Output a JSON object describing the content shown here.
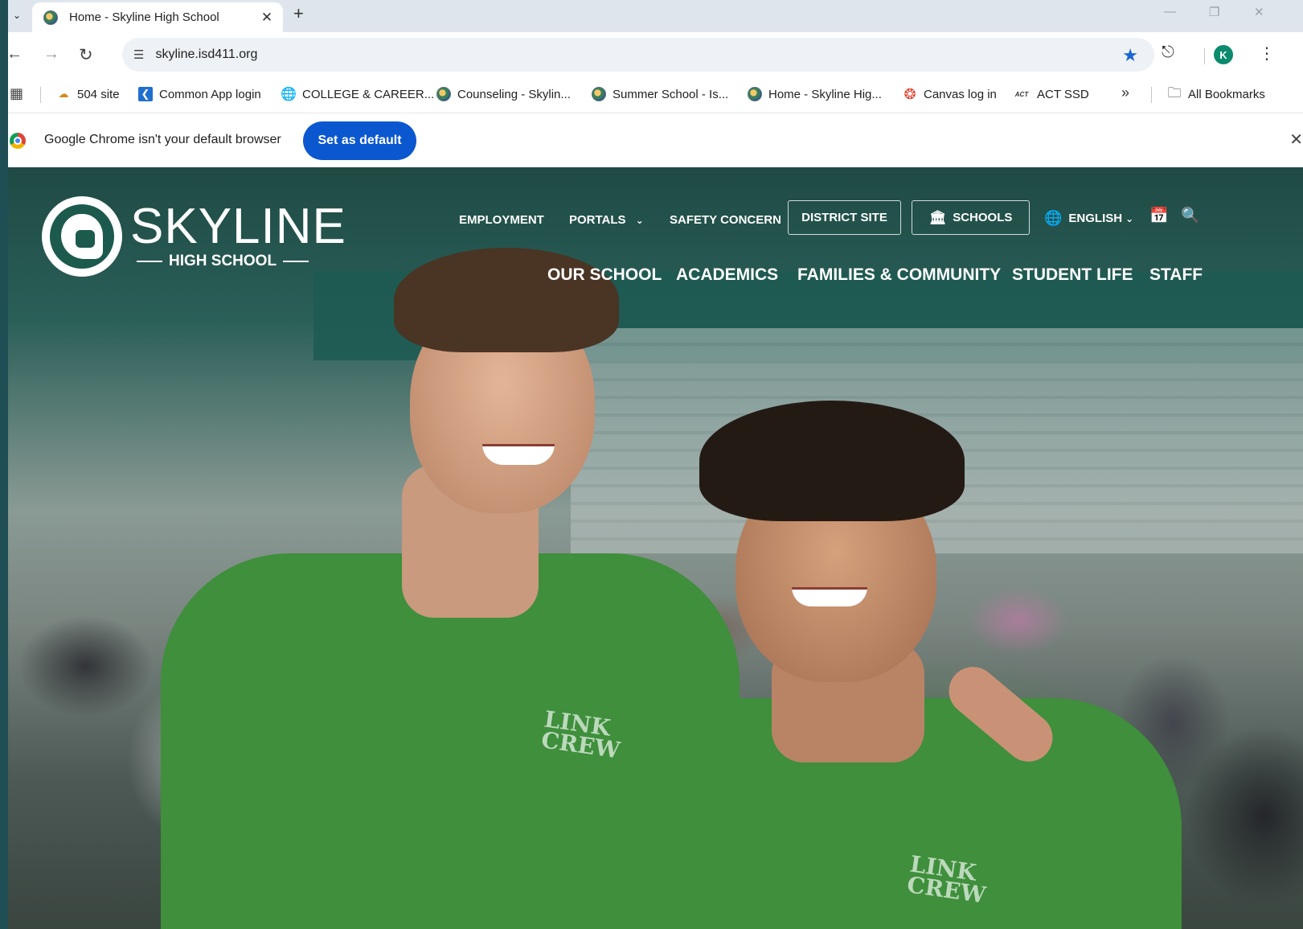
{
  "browser": {
    "tab": {
      "title": "Home - Skyline High School"
    },
    "new_tab_label": "+",
    "address_bar": {
      "url": "skyline.isd411.org"
    },
    "profile_initial": "K",
    "bookmarks": [
      {
        "label": "504 site",
        "icon": "cloud-icon"
      },
      {
        "label": "Common App login",
        "icon": "common-app-icon"
      },
      {
        "label": "COLLEGE & CAREER...",
        "icon": "globe-icon"
      },
      {
        "label": "Counseling - Skylin...",
        "icon": "school-favicon"
      },
      {
        "label": "Summer School - Is...",
        "icon": "school-favicon"
      },
      {
        "label": "Home - Skyline Hig...",
        "icon": "school-favicon"
      },
      {
        "label": "Canvas log in",
        "icon": "canvas-icon"
      },
      {
        "label": "ACT SSD",
        "icon": "act-icon",
        "icon_text": "ACT"
      }
    ],
    "bookmarks_more": "»",
    "all_bookmarks": "All Bookmarks",
    "infobar": {
      "message": "Google Chrome isn't your default browser",
      "button": "Set as default"
    }
  },
  "site": {
    "logo": {
      "name": "SKYLINE",
      "subtitle": "HIGH SCHOOL"
    },
    "utility_nav": {
      "employment": "EMPLOYMENT",
      "portals": "PORTALS",
      "safety": "SAFETY CONCERN",
      "district": "DISTRICT SITE",
      "schools": "SCHOOLS",
      "language": "ENGLISH"
    },
    "main_nav": [
      "OUR SCHOOL",
      "ACADEMICS",
      "FAMILIES & COMMUNITY",
      "STUDENT LIFE",
      "STAFF"
    ],
    "shirt_logo": "LINK CREW"
  },
  "colors": {
    "brand_green": "#1c5a4e",
    "chrome_blue": "#0b57d0",
    "star_blue": "#1a66d2"
  }
}
